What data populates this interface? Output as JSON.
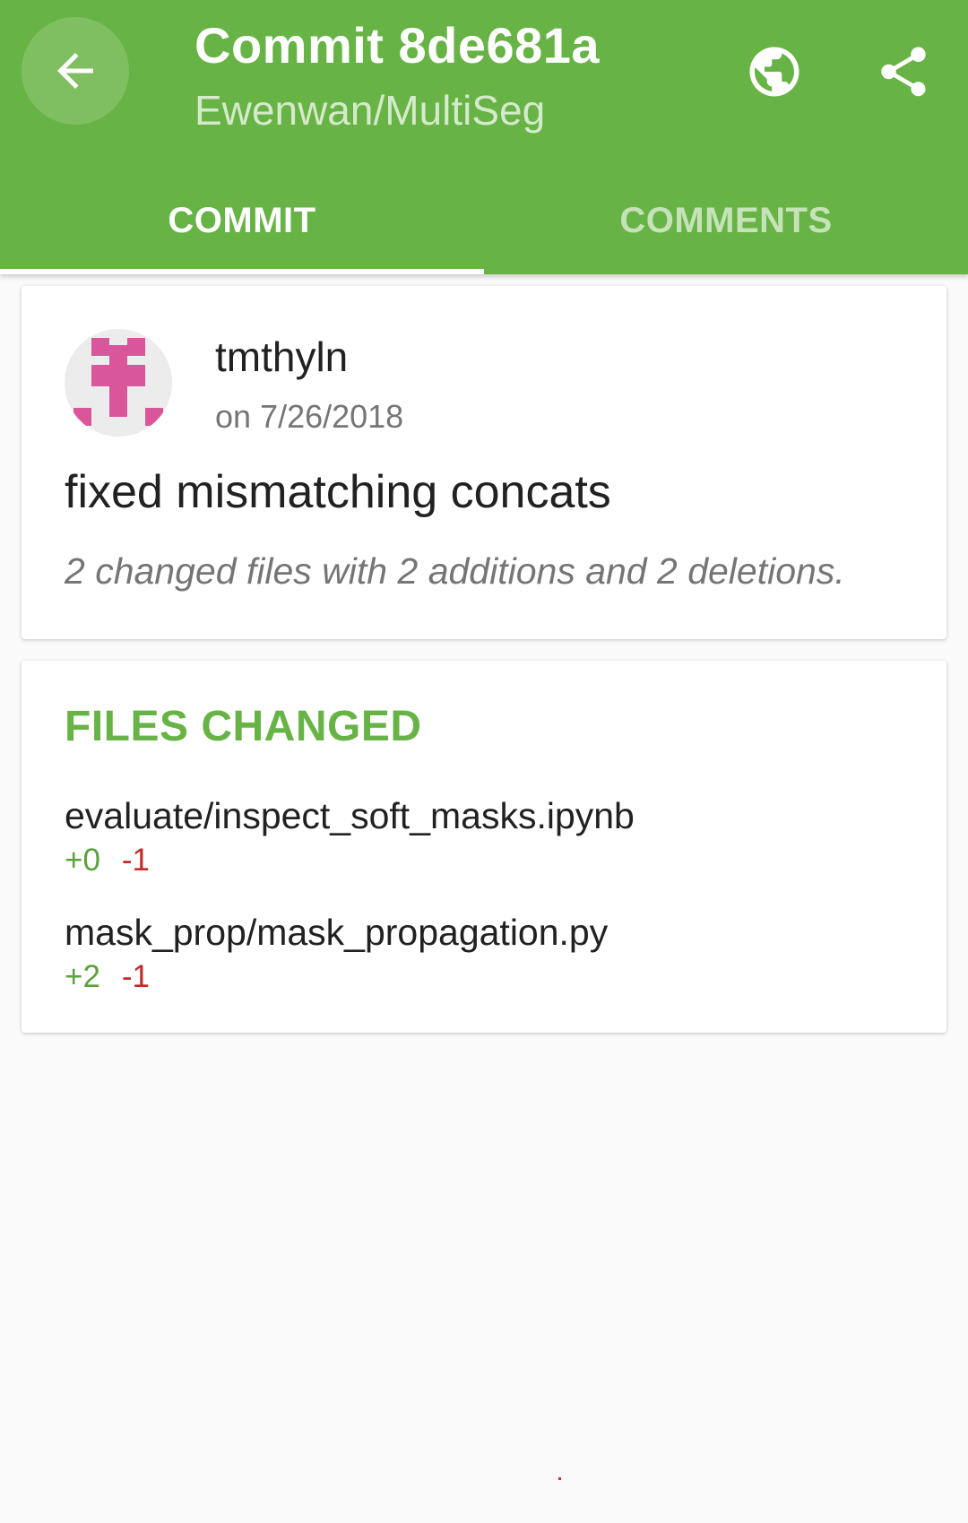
{
  "header": {
    "title": "Commit 8de681a",
    "subtitle": "Ewenwan/MultiSeg",
    "icons": {
      "back": "arrow-back-icon",
      "browser": "globe-icon",
      "share": "share-icon"
    },
    "tabs": [
      {
        "label": "COMMIT",
        "active": true
      },
      {
        "label": "COMMENTS",
        "active": false
      }
    ]
  },
  "commit": {
    "author": "tmthyln",
    "date": "on 7/26/2018",
    "message": "fixed mismatching concats",
    "summary": "2 changed files with 2 additions and 2 deletions."
  },
  "files": {
    "header": "FILES CHANGED",
    "items": [
      {
        "name": "evaluate/inspect_soft_masks.ipynb",
        "additions": "+0",
        "deletions": "-1"
      },
      {
        "name": "mask_prop/mask_propagation.py",
        "additions": "+2",
        "deletions": "-1"
      }
    ]
  },
  "colors": {
    "primary": "#67b345",
    "addition": "#5ba23b",
    "deletion": "#c62828",
    "avatar": "#d9569b"
  }
}
